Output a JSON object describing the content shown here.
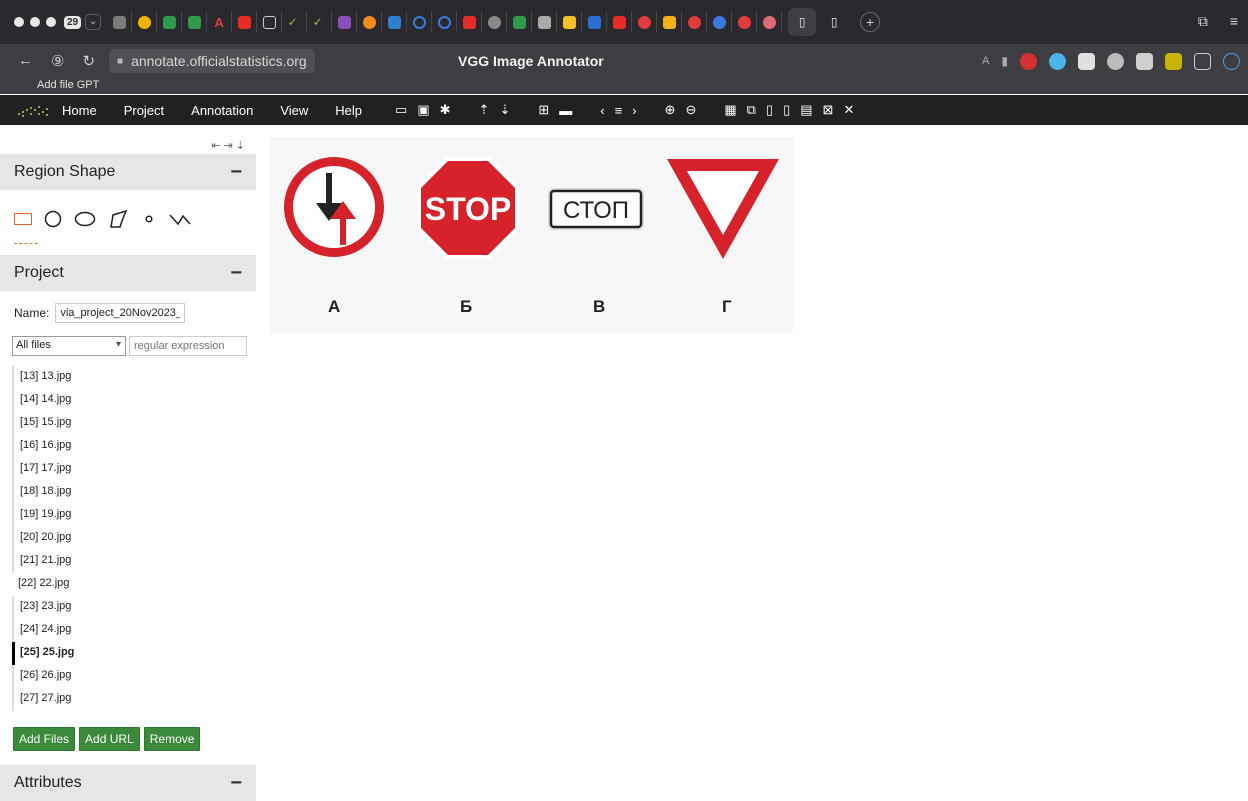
{
  "browser": {
    "tab_count": "29",
    "url": "annotate.officialstatistics.org",
    "page_title": "VGG Image Annotator",
    "bookmark": "Add file GPT",
    "colors": {
      "chrome_dark": "#2a2a2e",
      "toolbar": "#3d3d42"
    }
  },
  "menu": {
    "items": [
      "Home",
      "Project",
      "Annotation",
      "View",
      "Help"
    ]
  },
  "region_shape": {
    "title": "Region Shape",
    "shapes": [
      "rectangle",
      "circle",
      "ellipse",
      "polygon",
      "point",
      "polyline"
    ]
  },
  "project": {
    "title": "Project",
    "name_label": "Name:",
    "name_value": "via_project_20Nov2023_",
    "filter_option": "All files",
    "filter_placeholder": "regular expression",
    "files": [
      {
        "label": "[13] 13.jpg",
        "state": "normal"
      },
      {
        "label": "[14] 14.jpg",
        "state": "normal"
      },
      {
        "label": "[15] 15.jpg",
        "state": "normal"
      },
      {
        "label": "[16] 16.jpg",
        "state": "normal"
      },
      {
        "label": "[17] 17.jpg",
        "state": "normal"
      },
      {
        "label": "[18] 18.jpg",
        "state": "normal"
      },
      {
        "label": "[19] 19.jpg",
        "state": "normal"
      },
      {
        "label": "[20] 20.jpg",
        "state": "normal"
      },
      {
        "label": "[21] 21.jpg",
        "state": "normal"
      },
      {
        "label": "[22] 22.jpg",
        "state": "plain"
      },
      {
        "label": "[23] 23.jpg",
        "state": "normal"
      },
      {
        "label": "[24] 24.jpg",
        "state": "normal"
      },
      {
        "label": "[25] 25.jpg",
        "state": "current"
      },
      {
        "label": "[26] 26.jpg",
        "state": "normal"
      },
      {
        "label": "[27] 27.jpg",
        "state": "normal"
      }
    ],
    "buttons": {
      "add_files": "Add Files",
      "add_url": "Add URL",
      "remove": "Remove"
    }
  },
  "attributes": {
    "title": "Attributes"
  },
  "image": {
    "labels": [
      "А",
      "Б",
      "В",
      "Г"
    ],
    "stop_text": "STOP",
    "stop_ru_text": "СТОП",
    "colors": {
      "sign_red": "#d6222b"
    }
  }
}
